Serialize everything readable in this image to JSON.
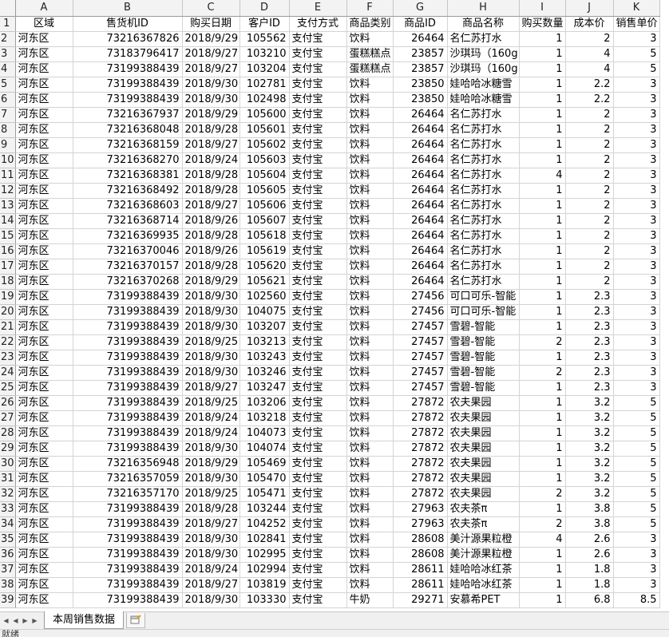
{
  "spreadsheet": {
    "columns": [
      "A",
      "B",
      "C",
      "D",
      "E",
      "F",
      "G",
      "H",
      "I",
      "J",
      "K"
    ],
    "header_row": [
      "区域",
      "售货机ID",
      "购买日期",
      "客户ID",
      "支付方式",
      "商品类别",
      "商品ID",
      "商品名称",
      "购买数量",
      "成本价",
      "销售单价"
    ],
    "rows": [
      [
        "河东区",
        "73216367826",
        "2018/9/29",
        "105562",
        "支付宝",
        "饮料",
        "26464",
        "名仁苏打水",
        "1",
        "2",
        "3"
      ],
      [
        "河东区",
        "73183796417",
        "2018/9/27",
        "103210",
        "支付宝",
        "蛋糕糕点",
        "23857",
        "沙琪玛（160g",
        "1",
        "4",
        "5"
      ],
      [
        "河东区",
        "73199388439",
        "2018/9/27",
        "103204",
        "支付宝",
        "蛋糕糕点",
        "23857",
        "沙琪玛（160g",
        "1",
        "4",
        "5"
      ],
      [
        "河东区",
        "73199388439",
        "2018/9/30",
        "102781",
        "支付宝",
        "饮料",
        "23850",
        "娃哈哈冰糖雪",
        "1",
        "2.2",
        "3"
      ],
      [
        "河东区",
        "73199388439",
        "2018/9/30",
        "102498",
        "支付宝",
        "饮料",
        "23850",
        "娃哈哈冰糖雪",
        "1",
        "2.2",
        "3"
      ],
      [
        "河东区",
        "73216367937",
        "2018/9/29",
        "105600",
        "支付宝",
        "饮料",
        "26464",
        "名仁苏打水",
        "1",
        "2",
        "3"
      ],
      [
        "河东区",
        "73216368048",
        "2018/9/28",
        "105601",
        "支付宝",
        "饮料",
        "26464",
        "名仁苏打水",
        "1",
        "2",
        "3"
      ],
      [
        "河东区",
        "73216368159",
        "2018/9/27",
        "105602",
        "支付宝",
        "饮料",
        "26464",
        "名仁苏打水",
        "1",
        "2",
        "3"
      ],
      [
        "河东区",
        "73216368270",
        "2018/9/24",
        "105603",
        "支付宝",
        "饮料",
        "26464",
        "名仁苏打水",
        "1",
        "2",
        "3"
      ],
      [
        "河东区",
        "73216368381",
        "2018/9/28",
        "105604",
        "支付宝",
        "饮料",
        "26464",
        "名仁苏打水",
        "4",
        "2",
        "3"
      ],
      [
        "河东区",
        "73216368492",
        "2018/9/28",
        "105605",
        "支付宝",
        "饮料",
        "26464",
        "名仁苏打水",
        "1",
        "2",
        "3"
      ],
      [
        "河东区",
        "73216368603",
        "2018/9/27",
        "105606",
        "支付宝",
        "饮料",
        "26464",
        "名仁苏打水",
        "1",
        "2",
        "3"
      ],
      [
        "河东区",
        "73216368714",
        "2018/9/26",
        "105607",
        "支付宝",
        "饮料",
        "26464",
        "名仁苏打水",
        "1",
        "2",
        "3"
      ],
      [
        "河东区",
        "73216369935",
        "2018/9/28",
        "105618",
        "支付宝",
        "饮料",
        "26464",
        "名仁苏打水",
        "1",
        "2",
        "3"
      ],
      [
        "河东区",
        "73216370046",
        "2018/9/26",
        "105619",
        "支付宝",
        "饮料",
        "26464",
        "名仁苏打水",
        "1",
        "2",
        "3"
      ],
      [
        "河东区",
        "73216370157",
        "2018/9/28",
        "105620",
        "支付宝",
        "饮料",
        "26464",
        "名仁苏打水",
        "1",
        "2",
        "3"
      ],
      [
        "河东区",
        "73216370268",
        "2018/9/29",
        "105621",
        "支付宝",
        "饮料",
        "26464",
        "名仁苏打水",
        "1",
        "2",
        "3"
      ],
      [
        "河东区",
        "73199388439",
        "2018/9/30",
        "102560",
        "支付宝",
        "饮料",
        "27456",
        "可口可乐-智能",
        "1",
        "2.3",
        "3"
      ],
      [
        "河东区",
        "73199388439",
        "2018/9/30",
        "104075",
        "支付宝",
        "饮料",
        "27456",
        "可口可乐-智能",
        "1",
        "2.3",
        "3"
      ],
      [
        "河东区",
        "73199388439",
        "2018/9/30",
        "103207",
        "支付宝",
        "饮料",
        "27457",
        "雪碧-智能",
        "1",
        "2.3",
        "3"
      ],
      [
        "河东区",
        "73199388439",
        "2018/9/25",
        "103213",
        "支付宝",
        "饮料",
        "27457",
        "雪碧-智能",
        "2",
        "2.3",
        "3"
      ],
      [
        "河东区",
        "73199388439",
        "2018/9/30",
        "103243",
        "支付宝",
        "饮料",
        "27457",
        "雪碧-智能",
        "1",
        "2.3",
        "3"
      ],
      [
        "河东区",
        "73199388439",
        "2018/9/30",
        "103246",
        "支付宝",
        "饮料",
        "27457",
        "雪碧-智能",
        "2",
        "2.3",
        "3"
      ],
      [
        "河东区",
        "73199388439",
        "2018/9/27",
        "103247",
        "支付宝",
        "饮料",
        "27457",
        "雪碧-智能",
        "1",
        "2.3",
        "3"
      ],
      [
        "河东区",
        "73199388439",
        "2018/9/25",
        "103206",
        "支付宝",
        "饮料",
        "27872",
        "农夫果园",
        "1",
        "3.2",
        "5"
      ],
      [
        "河东区",
        "73199388439",
        "2018/9/24",
        "103218",
        "支付宝",
        "饮料",
        "27872",
        "农夫果园",
        "1",
        "3.2",
        "5"
      ],
      [
        "河东区",
        "73199388439",
        "2018/9/24",
        "104073",
        "支付宝",
        "饮料",
        "27872",
        "农夫果园",
        "1",
        "3.2",
        "5"
      ],
      [
        "河东区",
        "73199388439",
        "2018/9/30",
        "104074",
        "支付宝",
        "饮料",
        "27872",
        "农夫果园",
        "1",
        "3.2",
        "5"
      ],
      [
        "河东区",
        "73216356948",
        "2018/9/29",
        "105469",
        "支付宝",
        "饮料",
        "27872",
        "农夫果园",
        "1",
        "3.2",
        "5"
      ],
      [
        "河东区",
        "73216357059",
        "2018/9/30",
        "105470",
        "支付宝",
        "饮料",
        "27872",
        "农夫果园",
        "1",
        "3.2",
        "5"
      ],
      [
        "河东区",
        "73216357170",
        "2018/9/25",
        "105471",
        "支付宝",
        "饮料",
        "27872",
        "农夫果园",
        "2",
        "3.2",
        "5"
      ],
      [
        "河东区",
        "73199388439",
        "2018/9/28",
        "103244",
        "支付宝",
        "饮料",
        "27963",
        "农夫茶π",
        "1",
        "3.8",
        "5"
      ],
      [
        "河东区",
        "73199388439",
        "2018/9/27",
        "104252",
        "支付宝",
        "饮料",
        "27963",
        "农夫茶π",
        "2",
        "3.8",
        "5"
      ],
      [
        "河东区",
        "73199388439",
        "2018/9/30",
        "102841",
        "支付宝",
        "饮料",
        "28608",
        "美汁源果粒橙",
        "4",
        "2.6",
        "3"
      ],
      [
        "河东区",
        "73199388439",
        "2018/9/30",
        "102995",
        "支付宝",
        "饮料",
        "28608",
        "美汁源果粒橙",
        "1",
        "2.6",
        "3"
      ],
      [
        "河东区",
        "73199388439",
        "2018/9/24",
        "102994",
        "支付宝",
        "饮料",
        "28611",
        "娃哈哈冰红茶",
        "1",
        "1.8",
        "3"
      ],
      [
        "河东区",
        "73199388439",
        "2018/9/27",
        "103819",
        "支付宝",
        "饮料",
        "28611",
        "娃哈哈冰红茶",
        "1",
        "1.8",
        "3"
      ],
      [
        "河东区",
        "73199388439",
        "2018/9/30",
        "103330",
        "支付宝",
        "牛奶",
        "29271",
        "安慕希PET",
        "1",
        "6.8",
        "8.5"
      ]
    ]
  },
  "sheet_tabs": {
    "active": "本周销售数据"
  },
  "status": {
    "text": "就绪"
  },
  "icons": {
    "nav_first": "first-sheet-icon",
    "nav_prev": "prev-sheet-icon",
    "nav_next": "next-sheet-icon",
    "nav_last": "last-sheet-icon",
    "new_sheet": "new-sheet-icon"
  }
}
